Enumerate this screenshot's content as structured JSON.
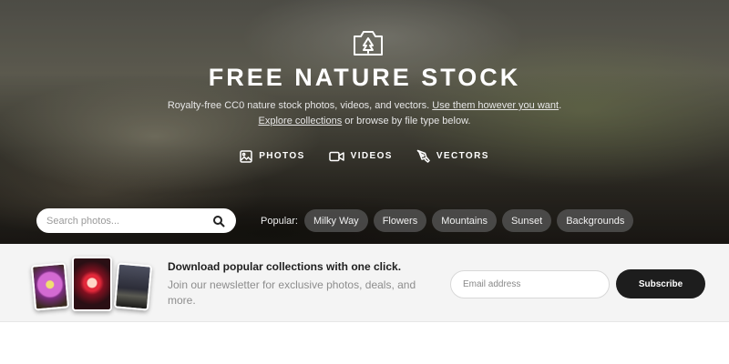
{
  "hero": {
    "logo_icon": "camera-tree-icon",
    "title": "FREE NATURE STOCK",
    "subtitle_line1_text": "Royalty-free CC0 nature stock photos, videos, and vectors. ",
    "subtitle_line1_link": "Use them however you want",
    "subtitle_line1_end": ".",
    "subtitle_line2_link": "Explore collections",
    "subtitle_line2_text": " or browse by file type below."
  },
  "type_nav": [
    {
      "label": "PHOTOS",
      "icon": "image-icon"
    },
    {
      "label": "VIDEOS",
      "icon": "video-camera-icon"
    },
    {
      "label": "VECTORS",
      "icon": "pen-tool-icon"
    }
  ],
  "search": {
    "placeholder": "Search photos...",
    "icon": "search-icon"
  },
  "popular": {
    "label": "Popular:",
    "tags": [
      "Milky Way",
      "Flowers",
      "Mountains",
      "Sunset",
      "Backgrounds"
    ]
  },
  "newsletter": {
    "title": "Download popular collections with one click.",
    "text": "Join our newsletter for exclusive photos, deals, and more.",
    "email_placeholder": "Email address",
    "subscribe_label": "Subscribe"
  }
}
